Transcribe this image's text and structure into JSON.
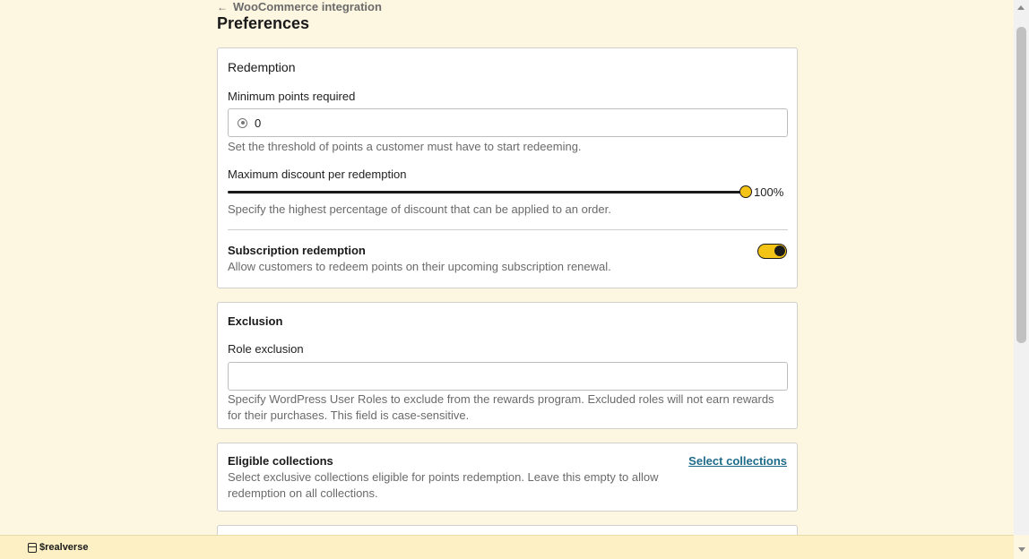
{
  "header": {
    "back_label": "WooCommerce integration",
    "title": "Preferences"
  },
  "redemption": {
    "title": "Redemption",
    "min_points_label": "Minimum points required",
    "min_points_value": "0",
    "min_points_help": "Set the threshold of points a customer must have to start redeeming.",
    "max_discount_label": "Maximum discount per redemption",
    "max_discount_value": "100%",
    "max_discount_fraction": 1.0,
    "max_discount_help": "Specify the highest percentage of discount that can be applied to an order.",
    "subscription_title": "Subscription redemption",
    "subscription_help": "Allow customers to redeem points on their upcoming subscription renewal.",
    "subscription_enabled": true
  },
  "exclusion": {
    "title": "Exclusion",
    "role_label": "Role exclusion",
    "role_value": "",
    "role_help_line1": "Specify WordPress User Roles to exclude from the rewards program. Excluded roles will not earn rewards",
    "role_help_line2": "for their purchases. This field is case-sensitive."
  },
  "collections": {
    "title": "Eligible collections",
    "link_label": "Select collections",
    "help_line1": "Select exclusive collections eligible for points redemption. Leave this empty to allow",
    "help_line2": "redemption on all collections."
  },
  "footer": {
    "brand": "$realverse",
    "icon": "store-icon"
  },
  "colors": {
    "background": "#fdf6e0",
    "accent": "#f3c316",
    "link": "#1f6b8a",
    "footer": "#fcf0c4"
  }
}
